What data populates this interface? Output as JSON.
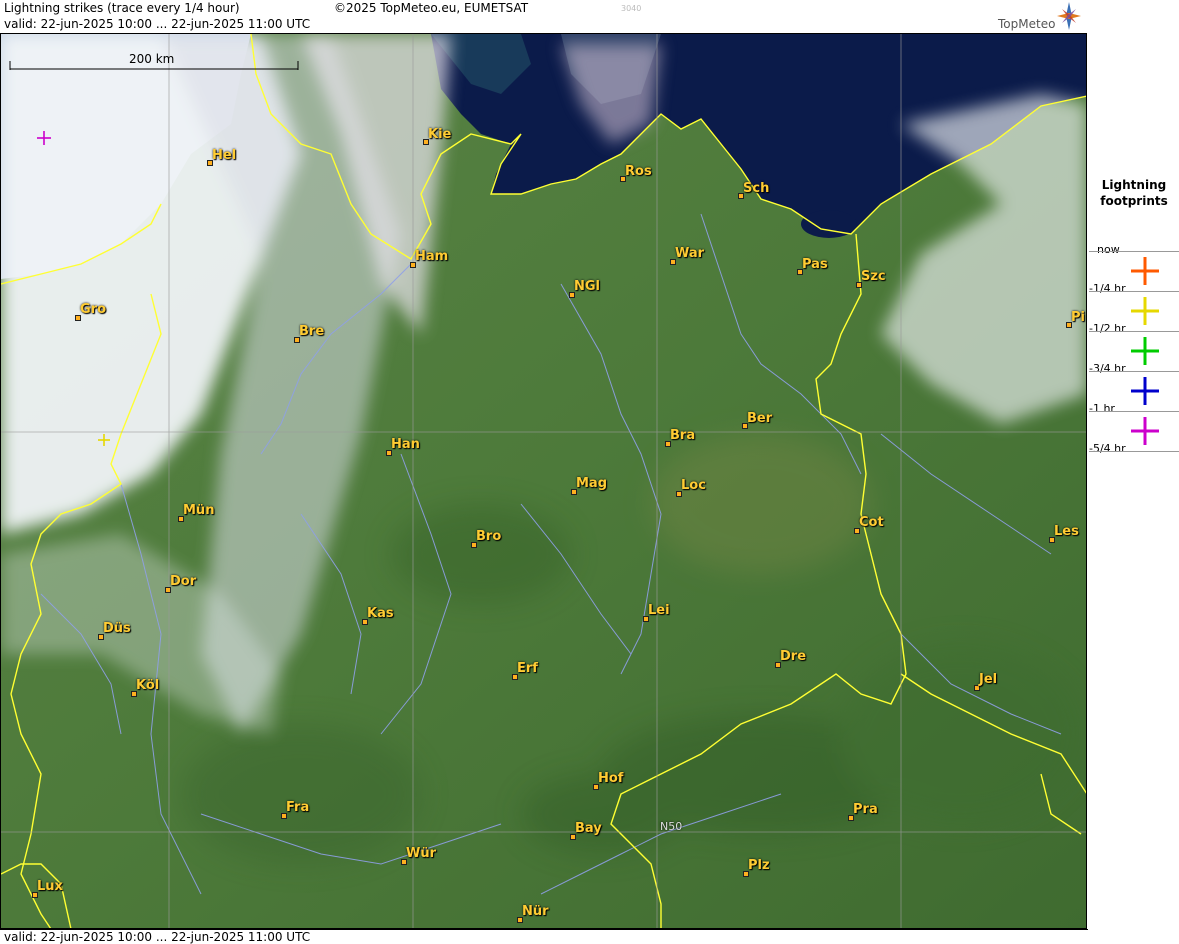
{
  "header": {
    "title": "Lightning strikes (trace every 1/4 hour)",
    "copyright": "©2025 TopMeteo.eu, EUMETSAT",
    "code": "3040",
    "valid": "valid:  22-jun-2025 10:00 ... 22-jun-2025 11:00 UTC",
    "brand": "TopMeteo"
  },
  "footer": {
    "valid": "valid:  22-jun-2025 10:00 ... 22-jun-2025 11:00 UTC"
  },
  "scale": {
    "label": "200 km"
  },
  "grid_label": "N50",
  "legend": {
    "title": "Lightning footprints",
    "entries": [
      {
        "label": "now",
        "color": null
      },
      {
        "label": "-1/4 hr",
        "color": "#ff5a00"
      },
      {
        "label": "-1/2 hr",
        "color": "#e6d800"
      },
      {
        "label": "-3/4 hr",
        "color": "#00cc00"
      },
      {
        "label": "-1 hr",
        "color": "#0000cc"
      },
      {
        "label": "-5/4 hr",
        "color": "#cc00cc"
      }
    ]
  },
  "cities": [
    {
      "name": "Kie"
    },
    {
      "name": "Hel"
    },
    {
      "name": "Ros"
    },
    {
      "name": "Sch"
    },
    {
      "name": "Ham"
    },
    {
      "name": "War"
    },
    {
      "name": "Pas"
    },
    {
      "name": "Szc"
    },
    {
      "name": "NGl"
    },
    {
      "name": "Gro"
    },
    {
      "name": "Bre"
    },
    {
      "name": "Pi"
    },
    {
      "name": "Ber"
    },
    {
      "name": "Bra"
    },
    {
      "name": "Han"
    },
    {
      "name": "Mag"
    },
    {
      "name": "Loc"
    },
    {
      "name": "Mün"
    },
    {
      "name": "Cot"
    },
    {
      "name": "Bro"
    },
    {
      "name": "Les"
    },
    {
      "name": "Dor"
    },
    {
      "name": "Kas"
    },
    {
      "name": "Lei"
    },
    {
      "name": "Düs"
    },
    {
      "name": "Dre"
    },
    {
      "name": "Erf"
    },
    {
      "name": "Köl"
    },
    {
      "name": "Jel"
    },
    {
      "name": "Hof"
    },
    {
      "name": "Fra"
    },
    {
      "name": "Pra"
    },
    {
      "name": "Bay"
    },
    {
      "name": "Wür"
    },
    {
      "name": "Plz"
    },
    {
      "name": "Lux"
    },
    {
      "name": "Nür"
    }
  ],
  "strikes": [
    {
      "age": "-5/4 hr",
      "color": "#cc00cc"
    },
    {
      "age": "-1/2 hr",
      "color": "#e6d800"
    }
  ],
  "colors": {
    "land": "#4f7a3c",
    "sea": "#0b1b4a",
    "border": "#ffff33",
    "river": "#8fa0e8",
    "city": "#ffcc33"
  }
}
